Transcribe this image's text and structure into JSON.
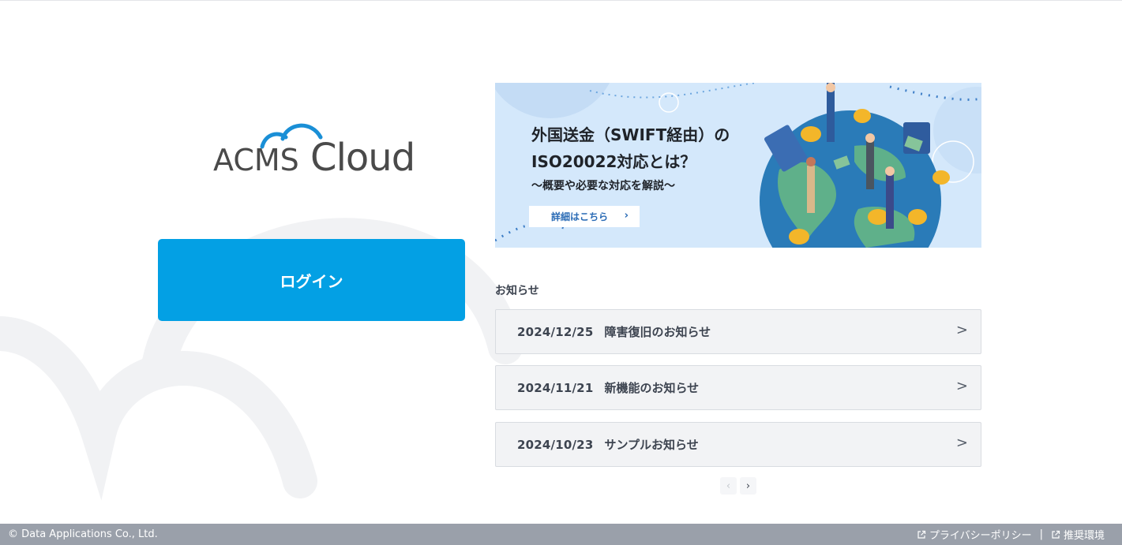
{
  "logo": {
    "text_acms": "ACMS",
    "text_cloud": "Cloud"
  },
  "login": {
    "label": "ログイン"
  },
  "banner": {
    "title_line1": "外国送金（SWIFT経由）の",
    "title_line2": "ISO20022対応とは？",
    "subtitle": "〜概要や必要な対応を解説〜",
    "cta_label": "詳細はこちら",
    "cta_chevron": "›"
  },
  "news": {
    "heading": "お知らせ",
    "items": [
      {
        "date": "2024/12/25",
        "title": "障害復旧のお知らせ",
        "chevron": ">"
      },
      {
        "date": "2024/11/21",
        "title": "新機能のお知らせ",
        "chevron": ">"
      },
      {
        "date": "2024/10/23",
        "title": "サンプルお知らせ",
        "chevron": ">"
      }
    ],
    "pager": {
      "prev": "‹",
      "next": "›"
    }
  },
  "footer": {
    "copyright": "© Data Applications Co., Ltd.",
    "privacy_label": "プライバシーポリシー",
    "separator": "|",
    "recommended_label": "推奨環境"
  },
  "colors": {
    "accent": "#03a0e4",
    "footer_bg": "#9aa0aa",
    "news_bg": "#f2f3f5",
    "banner_bg": "#d4e8fb"
  }
}
